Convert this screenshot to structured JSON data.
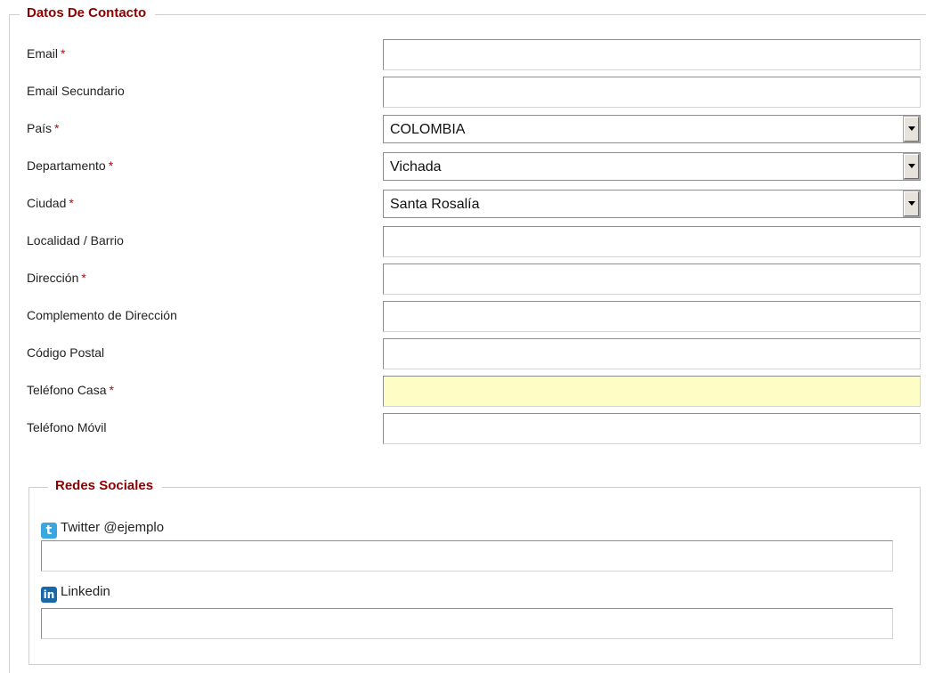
{
  "contact_section": {
    "legend": "Datos De Contacto",
    "required_mark": "*",
    "fields": [
      {
        "label": "Email",
        "required": true,
        "value": ""
      },
      {
        "label": "Email Secundario",
        "required": false,
        "value": ""
      },
      {
        "label": "País",
        "required": true,
        "value": "COLOMBIA"
      },
      {
        "label": "Departamento",
        "required": true,
        "value": "Vichada"
      },
      {
        "label": "Ciudad",
        "required": true,
        "value": "Santa Rosalía"
      },
      {
        "label": "Localidad / Barrio",
        "required": false,
        "value": ""
      },
      {
        "label": "Dirección",
        "required": true,
        "value": ""
      },
      {
        "label": "Complemento de Dirección",
        "required": false,
        "value": ""
      },
      {
        "label": "Código Postal",
        "required": false,
        "value": ""
      },
      {
        "label": "Teléfono Casa",
        "required": true,
        "value": ""
      },
      {
        "label": "Teléfono Móvil",
        "required": false,
        "value": ""
      }
    ]
  },
  "social_section": {
    "legend": "Redes Sociales",
    "twitter": {
      "label": "Twitter @ejemplo",
      "icon": "twitter-icon",
      "icon_glyph": "t",
      "value": ""
    },
    "linkedin": {
      "label": "Linkedin",
      "icon": "linkedin-icon",
      "icon_glyph": "in",
      "value": ""
    }
  },
  "colors": {
    "legend": "#8b0000",
    "required": "#cc0000",
    "focused_field_bg": "#fffdc6",
    "twitter_brand": "#3aa7de",
    "linkedin_brand": "#1a67a8"
  }
}
